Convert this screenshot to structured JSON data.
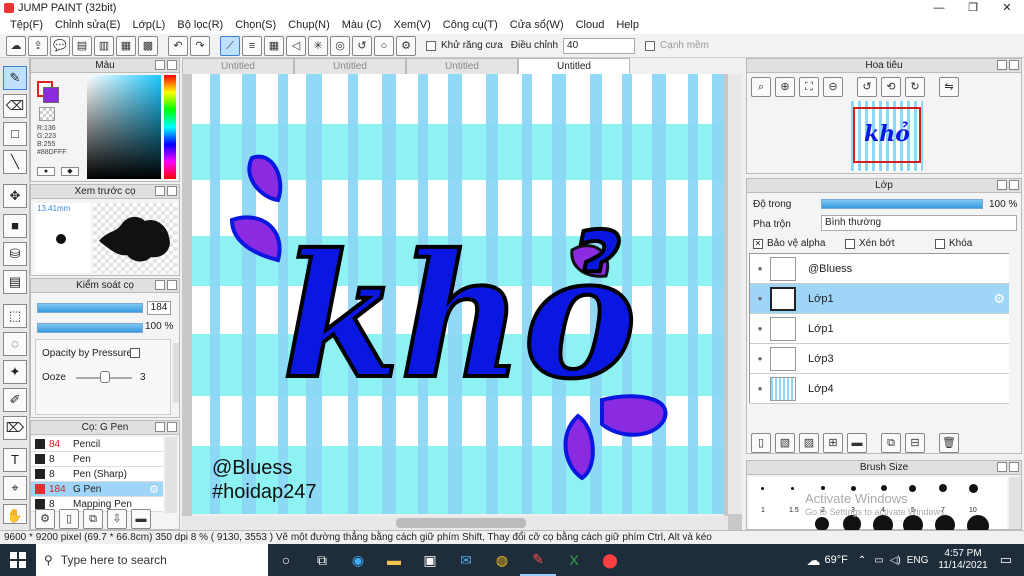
{
  "window": {
    "title": "JUMP PAINT (32bit)",
    "min": "—",
    "max": "❐",
    "close": "✕"
  },
  "menu": [
    "Tệp(F)",
    "Chỉnh sửa(E)",
    "Lớp(L)",
    "Bộ lọc(R)",
    "Chọn(S)",
    "Chụp(N)",
    "Màu (C)",
    "Xem(V)",
    "Công cụ(T)",
    "Cửa sổ(W)",
    "Cloud",
    "Help"
  ],
  "toolbar": {
    "antialias": "Khử răng cưa",
    "adjust_label": "Điều chỉnh",
    "adjust_value": "40",
    "grid_label": "Cạnh mềm"
  },
  "color_panel": {
    "title": "Màu",
    "r": "R:136",
    "g": "G:223",
    "b": "B:255",
    "hex": "#88DFFF"
  },
  "brush_preview": {
    "title": "Xem trước cọ",
    "size": "13.41mm"
  },
  "brush_control": {
    "title": "Kiểm soát cọ",
    "size_value": "184",
    "opacity_value": "100 %",
    "opacity_pressure": "Opacity by Pressure",
    "ooze_label": "Ooze",
    "ooze_value": "3"
  },
  "brush_list": {
    "title": "Cọ: G Pen",
    "items": [
      {
        "size": "84",
        "name": "Pencil",
        "color": "#222222"
      },
      {
        "size": "8",
        "name": "Pen",
        "color": "#222222"
      },
      {
        "size": "8",
        "name": "Pen (Sharp)",
        "color": "#222222"
      },
      {
        "size": "184",
        "name": "G Pen",
        "color": "#e03030"
      },
      {
        "size": "8",
        "name": "Mapping Pen",
        "color": "#222222"
      }
    ]
  },
  "tabs": [
    "Untitled",
    "Untitled",
    "Untitled",
    "Untitled"
  ],
  "canvas": {
    "word": "khỏ",
    "sig1": "@Bluess",
    "sig2": "#hoidap247",
    "bg_colors": {
      "stripe": "#8cd8f6",
      "band": "#8ef2f2",
      "ink": "#0a17e0",
      "purple": "#8a2be2"
    }
  },
  "navigator": {
    "title": "Hoa tiêu"
  },
  "layer_panel": {
    "title": "Lớp",
    "opacity_label": "Độ trong",
    "opacity_value": "100 %",
    "blend_label": "Pha trộn",
    "blend_value": "Bình thường",
    "protect_alpha": "Bảo vệ alpha",
    "clip": "Xén bớt",
    "lock": "Khóa",
    "layers": [
      "@Bluess",
      "Lớp1",
      "Lớp1",
      "Lớp3",
      "Lớp4"
    ]
  },
  "brush_size": {
    "title": "Brush Size",
    "labels": [
      "1",
      "1.5",
      "2",
      "3",
      "4",
      "5",
      "7",
      "10"
    ],
    "watermark1": "Activate Windows",
    "watermark2": "Go to Settings to activate Windows."
  },
  "status": "9600 * 9200 pixel   (69.7 * 66.8cm)   350 dpi   8 %   ( 9130, 3553 )   Vẽ một đường thẳng bằng cách giữ phím Shift, Thay đổi cỡ cọ bằng cách giữ phím Ctrl, Alt và kéo",
  "taskbar": {
    "search": "Type here to search",
    "weather": "69°F",
    "lang": "ENG",
    "time": "4:57 PM",
    "date": "11/14/2021"
  }
}
